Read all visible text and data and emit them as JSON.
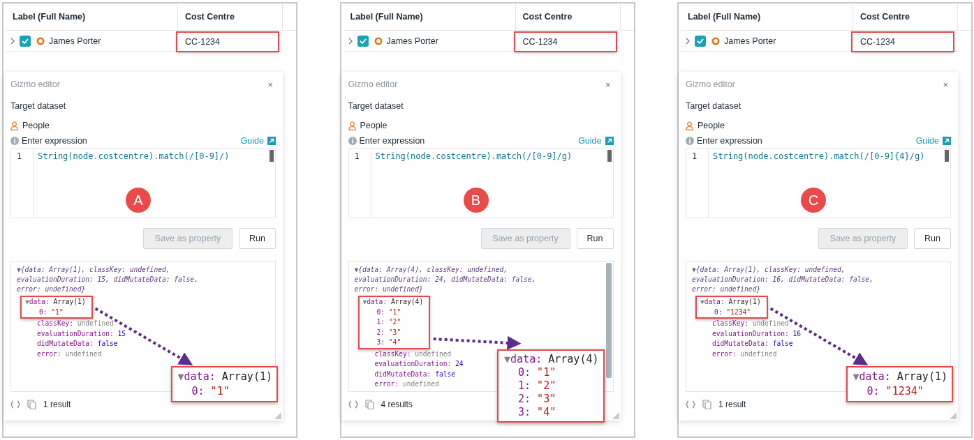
{
  "panels": [
    {
      "badge": "A",
      "table": {
        "columns": [
          "Label (Full Name)",
          "Cost Centre"
        ],
        "rows": [
          {
            "name": "James Porter",
            "checked": true,
            "cost_centre": "CC-1234",
            "highlighted": true
          }
        ]
      },
      "editor": {
        "title": "Gizmo editor",
        "close": "×",
        "target_label": "Target dataset",
        "dataset": "People",
        "expression_label": "Enter expression",
        "guide": "Guide",
        "line_number": "1",
        "code": "String(node.costcentre).match(/[0-9]/)",
        "buttons": [
          {
            "label": "Save as property",
            "disabled": true
          },
          {
            "label": "Run",
            "disabled": false
          }
        ],
        "output": {
          "scrollbar": false,
          "toggle": "▼",
          "summary": "{data: Array(1), classKey: undefined, evaluationDuration: 15, didMutateData: false, error: undefined}",
          "data_key": "data:",
          "data_value": "Array(1)",
          "items": [
            {
              "key": "0:",
              "value": "\"1\""
            }
          ],
          "props": [
            {
              "key": "classKey:",
              "value": "undefined",
              "kind": "undefined"
            },
            {
              "key": "evaluationDuration:",
              "value": "15",
              "kind": "number"
            },
            {
              "key": "didMutateData:",
              "value": "false",
              "kind": "boolean"
            },
            {
              "key": "error:",
              "value": "undefined",
              "kind": "undefined"
            }
          ]
        },
        "callout": {
          "data_key": "data:",
          "data_value": "Array(1)",
          "items": [
            {
              "key": "0:",
              "value": "\"1\""
            }
          ]
        },
        "result_count": "1 result"
      }
    },
    {
      "badge": "B",
      "table": {
        "columns": [
          "Label (Full Name)",
          "Cost Centre"
        ],
        "rows": [
          {
            "name": "James Porter",
            "checked": true,
            "cost_centre": "CC-1234",
            "highlighted": true
          }
        ]
      },
      "editor": {
        "title": "Gizmo editor",
        "close": "×",
        "target_label": "Target dataset",
        "dataset": "People",
        "expression_label": "Enter expression",
        "guide": "Guide",
        "line_number": "1",
        "code": "String(node.costcentre).match(/[0-9]/g)",
        "buttons": [
          {
            "label": "Save as property",
            "disabled": true
          },
          {
            "label": "Run",
            "disabled": false
          }
        ],
        "output": {
          "scrollbar": true,
          "toggle": "▼",
          "summary": "{data: Array(4), classKey: undefined, evaluationDuration: 24, didMutateData: false, error: undefined}",
          "data_key": "data:",
          "data_value": "Array(4)",
          "items": [
            {
              "key": "0:",
              "value": "\"1\""
            },
            {
              "key": "1:",
              "value": "\"2\""
            },
            {
              "key": "2:",
              "value": "\"3\""
            },
            {
              "key": "3:",
              "value": "\"4\""
            }
          ],
          "props": [
            {
              "key": "classKey:",
              "value": "undefined",
              "kind": "undefined"
            },
            {
              "key": "evaluationDuration:",
              "value": "24",
              "kind": "number"
            },
            {
              "key": "didMutateData:",
              "value": "false",
              "kind": "boolean"
            },
            {
              "key": "error:",
              "value": "undefined",
              "kind": "undefined"
            }
          ]
        },
        "callout": {
          "data_key": "data:",
          "data_value": "Array(4)",
          "items": [
            {
              "key": "0:",
              "value": "\"1\""
            },
            {
              "key": "1:",
              "value": "\"2\""
            },
            {
              "key": "2:",
              "value": "\"3\""
            },
            {
              "key": "3:",
              "value": "\"4\""
            }
          ]
        },
        "result_count": "4 results"
      }
    },
    {
      "badge": "C",
      "table": {
        "columns": [
          "Label (Full Name)",
          "Cost Centre"
        ],
        "rows": [
          {
            "name": "James Porter",
            "checked": true,
            "cost_centre": "CC-1234",
            "highlighted": true
          }
        ]
      },
      "editor": {
        "title": "Gizmo editor",
        "close": "×",
        "target_label": "Target dataset",
        "dataset": "People",
        "expression_label": "Enter expression",
        "guide": "Guide",
        "line_number": "1",
        "code": "String(node.costcentre).match(/[0-9]{4}/g)",
        "buttons": [
          {
            "label": "Save as property",
            "disabled": true
          },
          {
            "label": "Run",
            "disabled": false
          }
        ],
        "output": {
          "scrollbar": false,
          "toggle": "▼",
          "summary": "{data: Array(1), classKey: undefined, evaluationDuration: 16, didMutateData: false, error: undefined}",
          "data_key": "data:",
          "data_value": "Array(1)",
          "items": [
            {
              "key": "0:",
              "value": "\"1234\""
            }
          ],
          "props": [
            {
              "key": "classKey:",
              "value": "undefined",
              "kind": "undefined"
            },
            {
              "key": "evaluationDuration:",
              "value": "16",
              "kind": "number"
            },
            {
              "key": "didMutateData:",
              "value": "false",
              "kind": "boolean"
            },
            {
              "key": "error:",
              "value": "undefined",
              "kind": "undefined"
            }
          ]
        },
        "callout": {
          "data_key": "data:",
          "data_value": "Array(1)",
          "items": [
            {
              "key": "0:",
              "value": "\"1234\""
            }
          ]
        },
        "result_count": "1 result"
      }
    }
  ]
}
